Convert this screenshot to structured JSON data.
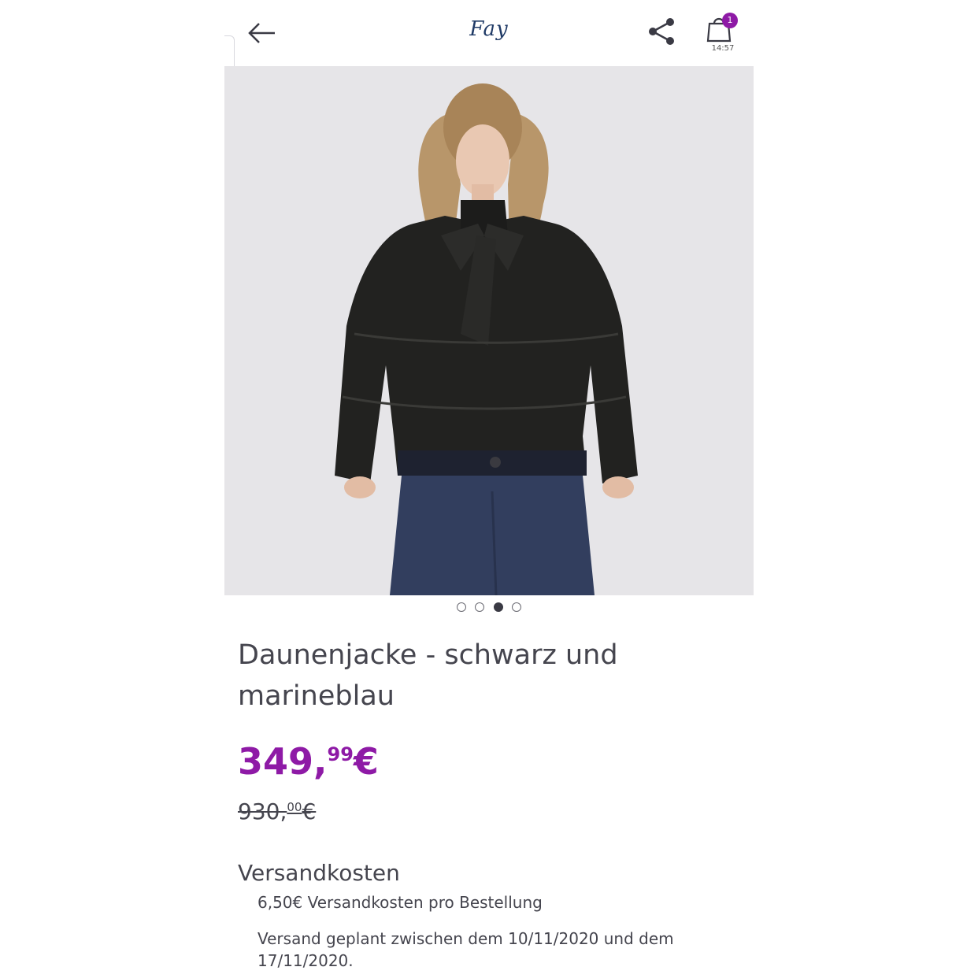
{
  "header": {
    "brand": "Fay",
    "cart_count": "1",
    "cart_time": "14:57"
  },
  "gallery": {
    "image_alt": "Daunenjacke",
    "total": 4,
    "active_index": 2
  },
  "product": {
    "title": "Daunenjacke - schwarz und marineblau",
    "price_main": "349,",
    "price_cents": "99",
    "price_currency": "€",
    "old_main": "930,",
    "old_cents": "00",
    "old_currency": "€"
  },
  "shipping": {
    "heading": "Versandkosten",
    "cost_text": "6,50€ Versandkosten pro Bestellung",
    "date_text": "Versand geplant zwischen dem 10/11/2020 und dem 17/11/2020."
  },
  "colors": {
    "accent": "#8e1aa6",
    "text": "#45454e",
    "brand": "#1f3a66"
  }
}
